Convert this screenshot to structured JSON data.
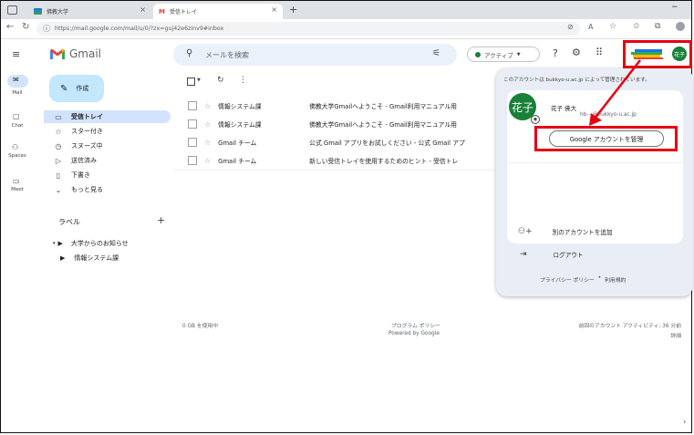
{
  "browser": {
    "tab1_title": "佛教大学",
    "tab2_title": "受信トレイ",
    "url": "https://mail.google.com/mail/u/0/?zx=guj42e6zinv9#inbox",
    "new_tab": "+",
    "close": "×",
    "min": "−"
  },
  "gmail": {
    "logo_text": "Gmail",
    "search_placeholder": "メールを検索",
    "status_label": "アクティブ",
    "avatar_text": "花子",
    "compose_label": "作成",
    "rail": [
      {
        "label": "Mail",
        "icon": "mail-icon"
      },
      {
        "label": "Chat",
        "icon": "chat-icon"
      },
      {
        "label": "Spaces",
        "icon": "spaces-icon"
      },
      {
        "label": "Meet",
        "icon": "meet-icon"
      }
    ],
    "nav": [
      {
        "label": "受信トレイ",
        "icon": "inbox-icon"
      },
      {
        "label": "スター付き",
        "icon": "star-icon"
      },
      {
        "label": "スヌーズ中",
        "icon": "clock-icon"
      },
      {
        "label": "送信済み",
        "icon": "send-icon"
      },
      {
        "label": "下書き",
        "icon": "draft-icon"
      },
      {
        "label": "もっと見る",
        "icon": "chevron-down-icon"
      }
    ],
    "labels_heading": "ラベル",
    "labels": [
      {
        "label": "大学からのお知らせ"
      },
      {
        "label": "情報システム課"
      }
    ],
    "emails": [
      {
        "sender": "情報システム課",
        "subject": "佛教大学Gmailへようこそ - Gmail利用マニュアル用"
      },
      {
        "sender": "情報システム課",
        "subject": "佛教大学Gmailへようこそ - Gmail利用マニュアル用"
      },
      {
        "sender": "Gmail チーム",
        "subject": "公式 Gmail アプリをお試しください - 公式 Gmail アプ"
      },
      {
        "sender": "Gmail チーム",
        "subject": "新しい受信トレイを使用するためのヒント - 受信トレ"
      }
    ],
    "footer": {
      "storage": "0 GB を使用中",
      "policy": "プログラム ポリシー",
      "powered": "Powered by Google",
      "activity": "前回のアカウント アクティビティ: 36 分前",
      "details": "詳細"
    },
    "account_popup": {
      "managed_note": "このアカウントは bukkyo-u.ac.jp によって管理されています。",
      "avatar_text": "花子",
      "name": "花子 佛大",
      "email": "hb---@bukkyo-u.ac.jp",
      "manage_button": "Google アカウントを管理",
      "add_account": "別のアカウントを追加",
      "logout": "ログアウト",
      "privacy": "プライバシー ポリシー",
      "dot": "•",
      "terms": "利用規約"
    }
  },
  "colors": {
    "annotation_red": "#e60012",
    "avatar_green": "#188038",
    "selected_nav": "#d3e3fd",
    "compose_bg": "#c2e7ff"
  }
}
